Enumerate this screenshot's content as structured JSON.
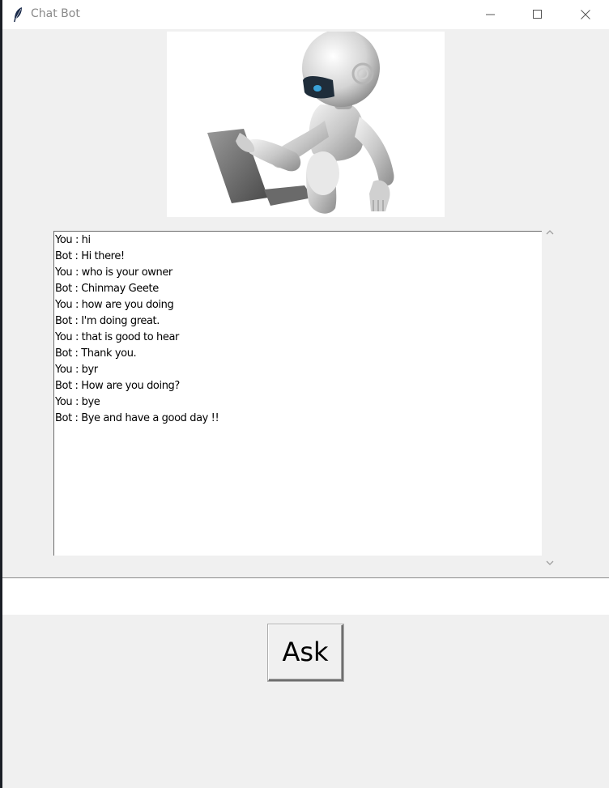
{
  "window": {
    "title": "Chat Bot",
    "controls": [
      "minimize",
      "maximize",
      "close"
    ]
  },
  "header_image": {
    "icon": "robot-with-laptop-image"
  },
  "chat": {
    "lines": [
      "You : hi",
      "Bot : Hi there!",
      "You : who is your owner",
      "Bot : Chinmay Geete",
      "You : how are you doing",
      "Bot : I'm doing great.",
      "You : that is good to hear",
      "Bot : Thank you.",
      "You : byr",
      "Bot : How are you doing?",
      "You : bye",
      "Bot : Bye and have a good day !!"
    ]
  },
  "input": {
    "value": "",
    "placeholder": ""
  },
  "ask_button": {
    "label": "Ask"
  },
  "colors": {
    "window_bg": "#f0f0f0",
    "titlebar_bg": "#ffffff",
    "title_text": "#8a8a8a",
    "text_bg": "#ffffff"
  }
}
